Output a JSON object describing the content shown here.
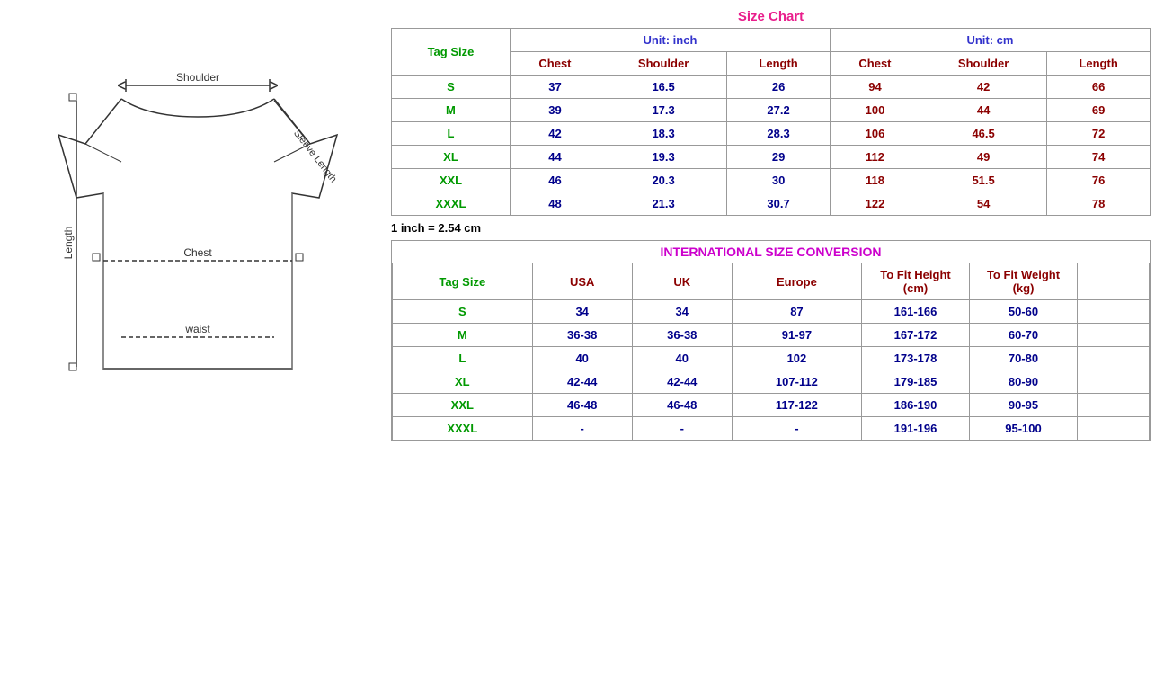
{
  "title": "Size Chart",
  "left": {
    "diagram_label": "T-shirt measurement diagram"
  },
  "size_chart": {
    "title": "Size Chart",
    "unit_inch": "Unit: inch",
    "unit_cm": "Unit: cm",
    "columns_inch": [
      "Chest",
      "Shoulder",
      "Length"
    ],
    "columns_cm": [
      "Chest",
      "Shoulder",
      "Length"
    ],
    "tag_size_label": "Tag Size",
    "rows": [
      {
        "tag": "S",
        "inch_chest": "37",
        "inch_shoulder": "16.5",
        "inch_length": "26",
        "cm_chest": "94",
        "cm_shoulder": "42",
        "cm_length": "66"
      },
      {
        "tag": "M",
        "inch_chest": "39",
        "inch_shoulder": "17.3",
        "inch_length": "27.2",
        "cm_chest": "100",
        "cm_shoulder": "44",
        "cm_length": "69"
      },
      {
        "tag": "L",
        "inch_chest": "42",
        "inch_shoulder": "18.3",
        "inch_length": "28.3",
        "cm_chest": "106",
        "cm_shoulder": "46.5",
        "cm_length": "72"
      },
      {
        "tag": "XL",
        "inch_chest": "44",
        "inch_shoulder": "19.3",
        "inch_length": "29",
        "cm_chest": "112",
        "cm_shoulder": "49",
        "cm_length": "74"
      },
      {
        "tag": "XXL",
        "inch_chest": "46",
        "inch_shoulder": "20.3",
        "inch_length": "30",
        "cm_chest": "118",
        "cm_shoulder": "51.5",
        "cm_length": "76"
      },
      {
        "tag": "XXXL",
        "inch_chest": "48",
        "inch_shoulder": "21.3",
        "inch_length": "30.7",
        "cm_chest": "122",
        "cm_shoulder": "54",
        "cm_length": "78"
      }
    ],
    "note": "1 inch = 2.54 cm"
  },
  "intl_conversion": {
    "title": "INTERNATIONAL SIZE CONVERSION",
    "tag_size_label": "Tag Size",
    "col_usa": "USA",
    "col_uk": "UK",
    "col_europe": "Europe",
    "col_height": "To Fit Height (cm)",
    "col_weight": "To Fit Weight (kg)",
    "rows": [
      {
        "tag": "S",
        "usa": "34",
        "uk": "34",
        "europe": "87",
        "height": "161-166",
        "weight": "50-60"
      },
      {
        "tag": "M",
        "usa": "36-38",
        "uk": "36-38",
        "europe": "91-97",
        "height": "167-172",
        "weight": "60-70"
      },
      {
        "tag": "L",
        "usa": "40",
        "uk": "40",
        "europe": "102",
        "height": "173-178",
        "weight": "70-80"
      },
      {
        "tag": "XL",
        "usa": "42-44",
        "uk": "42-44",
        "europe": "107-112",
        "height": "179-185",
        "weight": "80-90"
      },
      {
        "tag": "XXL",
        "usa": "46-48",
        "uk": "46-48",
        "europe": "117-122",
        "height": "186-190",
        "weight": "90-95"
      },
      {
        "tag": "XXXL",
        "usa": "-",
        "uk": "-",
        "europe": "-",
        "height": "191-196",
        "weight": "95-100"
      }
    ]
  }
}
